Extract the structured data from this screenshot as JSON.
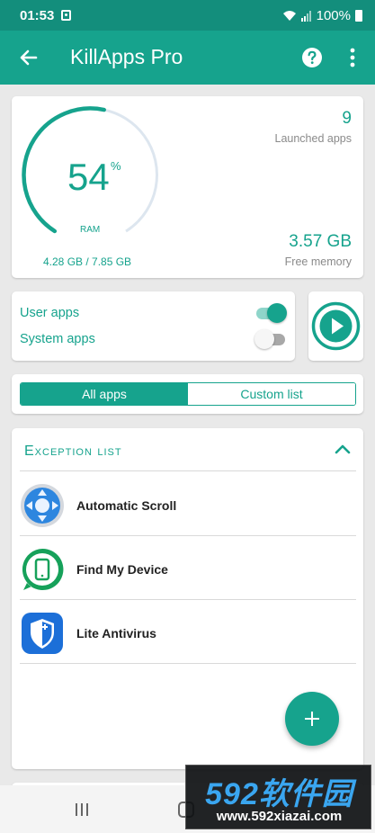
{
  "status_bar": {
    "time": "01:53",
    "battery": "100%"
  },
  "app_bar": {
    "title": "KillApps Pro"
  },
  "ram_card": {
    "percent_value": "54",
    "percent_sign": "%",
    "gauge_fraction": 0.54,
    "label": "RAM",
    "detail": "4.28 GB / 7.85 GB",
    "launched_count": "9",
    "launched_label": "Launched apps",
    "free_value": "3.57 GB",
    "free_label": "Free memory"
  },
  "filters": {
    "user_apps": {
      "label": "User apps",
      "on": true
    },
    "system_apps": {
      "label": "System apps",
      "on": false
    }
  },
  "tabs": [
    {
      "label": "All apps",
      "active": true
    },
    {
      "label": "Custom list",
      "active": false
    }
  ],
  "exception_list": {
    "title": "Exception list",
    "apps": [
      {
        "name": "Automatic Scroll",
        "icon": "compass-arrows-icon"
      },
      {
        "name": "Find My Device",
        "icon": "find-device-icon"
      },
      {
        "name": "Lite Antivirus",
        "icon": "shield-icon"
      }
    ]
  },
  "watermark": {
    "logo": "592软件园",
    "url": "www.592xiazai.com"
  },
  "colors": {
    "primary": "#16a38d",
    "primary_dark": "#138e7c",
    "accent_light": "#8fd5ca"
  }
}
